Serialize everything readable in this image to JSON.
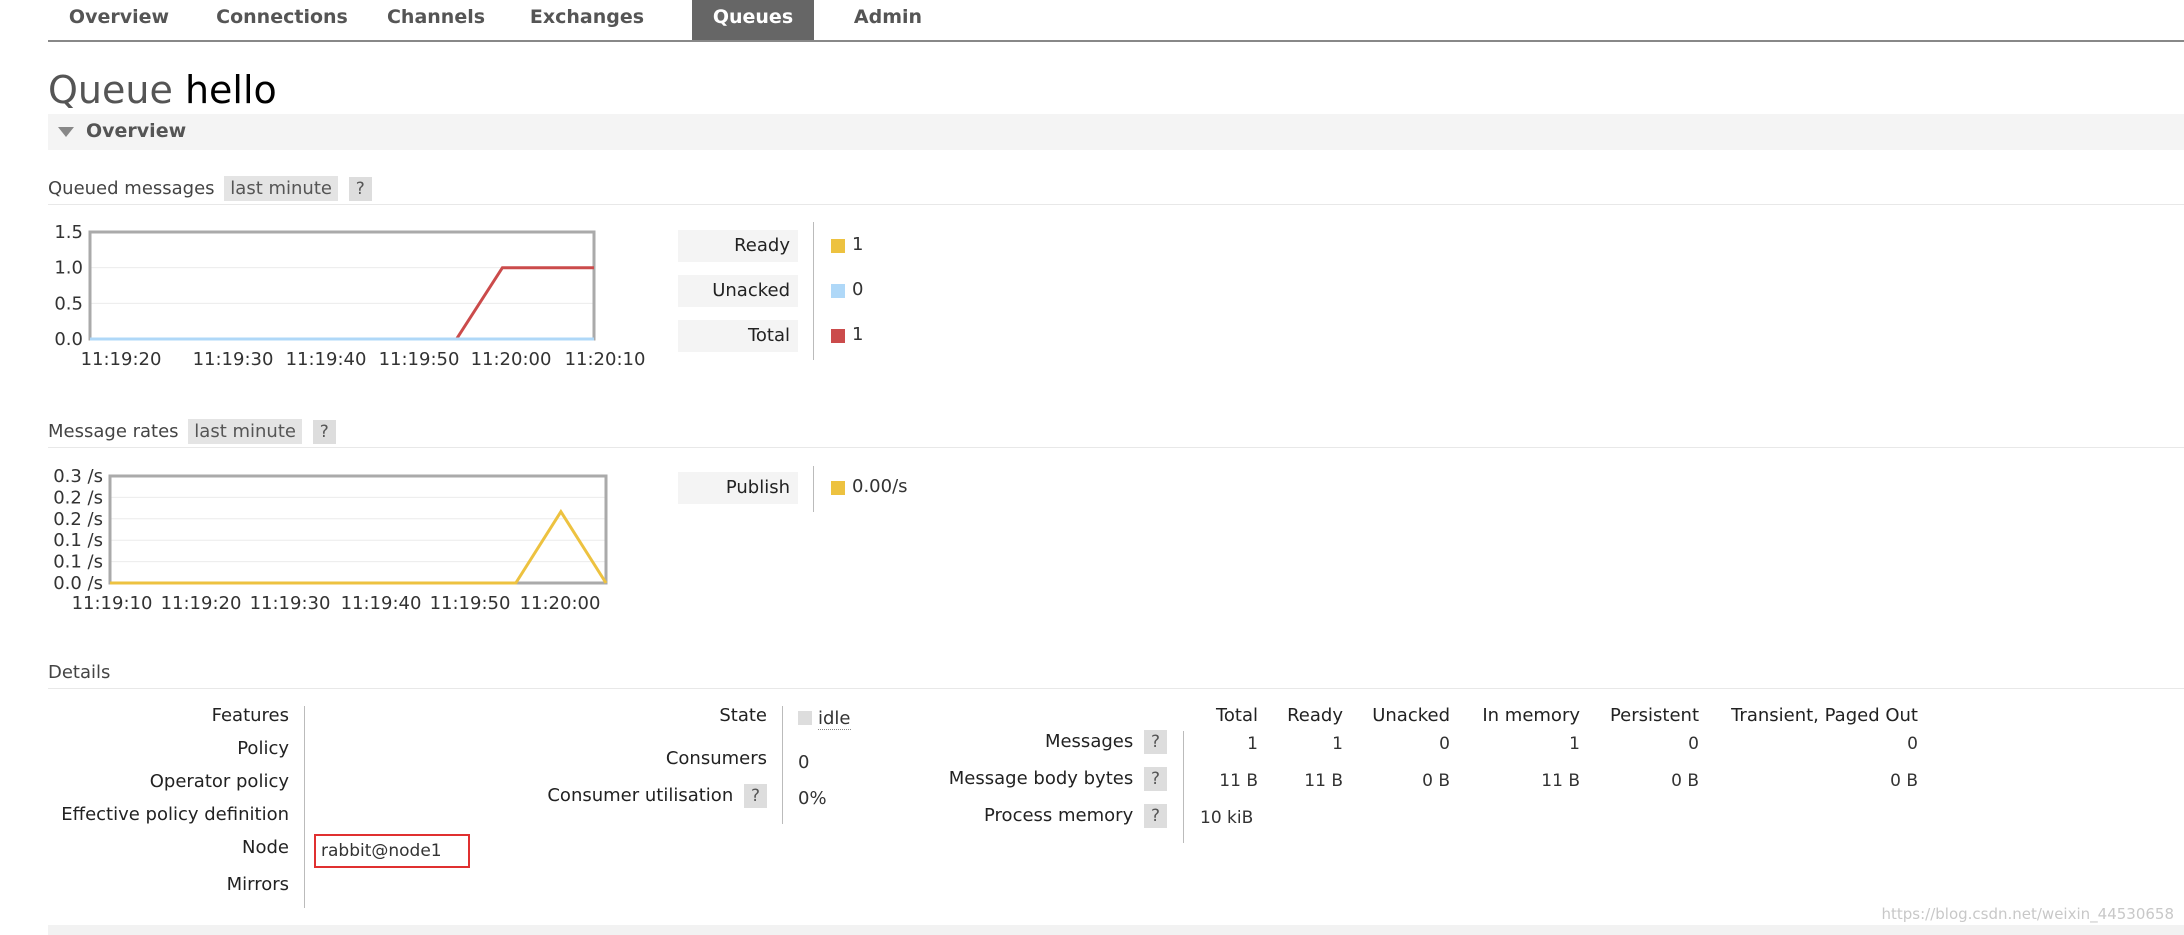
{
  "nav": {
    "tabs": [
      {
        "label": "Overview",
        "active": false
      },
      {
        "label": "Connections",
        "active": false
      },
      {
        "label": "Channels",
        "active": false
      },
      {
        "label": "Exchanges",
        "active": false
      },
      {
        "label": "Queues",
        "active": true
      },
      {
        "label": "Admin",
        "active": false
      }
    ]
  },
  "page": {
    "title_prefix": "Queue",
    "title_name": "hello",
    "section": "Overview"
  },
  "queued": {
    "label": "Queued messages",
    "range": "last minute",
    "help": "?",
    "legend": [
      {
        "name": "Ready",
        "value": "1",
        "color": "#edc240"
      },
      {
        "name": "Unacked",
        "value": "0",
        "color": "#afd8f8"
      },
      {
        "name": "Total",
        "value": "1",
        "color": "#cb4b4b"
      }
    ]
  },
  "rates": {
    "label": "Message rates",
    "range": "last minute",
    "help": "?",
    "legend": [
      {
        "name": "Publish",
        "value": "0.00/s",
        "color": "#edc240"
      }
    ]
  },
  "chart_data": [
    {
      "type": "line",
      "x": [
        0,
        10,
        20,
        30,
        40,
        45,
        50,
        55
      ],
      "xticks": [
        "11:19:20",
        "11:19:30",
        "11:19:40",
        "11:19:50",
        "11:20:00",
        "11:20:10"
      ],
      "yticks": [
        "0.0",
        "0.5",
        "1.0",
        "1.5"
      ],
      "ylim": [
        0,
        1.5
      ],
      "series": [
        {
          "name": "Total",
          "color": "#cb4b4b",
          "values": [
            0,
            0,
            0,
            0,
            0,
            1,
            1,
            1
          ]
        },
        {
          "name": "Unacked",
          "color": "#afd8f8",
          "values": [
            0,
            0,
            0,
            0,
            0,
            0,
            0,
            0
          ]
        }
      ]
    },
    {
      "type": "line",
      "x": [
        0,
        10,
        20,
        30,
        40,
        45,
        50,
        55
      ],
      "xticks": [
        "11:19:10",
        "11:19:20",
        "11:19:30",
        "11:19:40",
        "11:19:50",
        "11:20:00"
      ],
      "yticks": [
        "0.0 /s",
        "0.1 /s",
        "0.1 /s",
        "0.2 /s",
        "0.2 /s",
        "0.3 /s"
      ],
      "ylim": [
        0,
        0.3
      ],
      "series": [
        {
          "name": "Publish",
          "color": "#edc240",
          "values": [
            0,
            0,
            0,
            0,
            0,
            0,
            0.2,
            0
          ]
        }
      ]
    }
  ],
  "details": {
    "label": "Details",
    "features_label": "Features",
    "policy_label": "Policy",
    "operator_policy_label": "Operator policy",
    "effective_policy_label": "Effective policy definition",
    "node_label": "Node",
    "node_value": "rabbit@node1",
    "mirrors_label": "Mirrors",
    "state_label": "State",
    "state_value": "idle",
    "consumers_label": "Consumers",
    "consumers_value": "0",
    "utilisation_label": "Consumer utilisation",
    "utilisation_help": "?",
    "utilisation_value": "0%",
    "stats_headers": [
      "Total",
      "Ready",
      "Unacked",
      "In memory",
      "Persistent",
      "Transient, Paged Out"
    ],
    "stats_rows": [
      {
        "label": "Messages",
        "help": "?",
        "cells": [
          "1",
          "1",
          "0",
          "1",
          "0",
          "0"
        ]
      },
      {
        "label": "Message body bytes",
        "help": "?",
        "cells": [
          "11 B",
          "11 B",
          "0 B",
          "11 B",
          "0 B",
          "0 B"
        ]
      },
      {
        "label": "Process memory",
        "help": "?",
        "cells": [
          "10 kiB"
        ]
      }
    ]
  },
  "watermark": "https://blog.csdn.net/weixin_44530658"
}
